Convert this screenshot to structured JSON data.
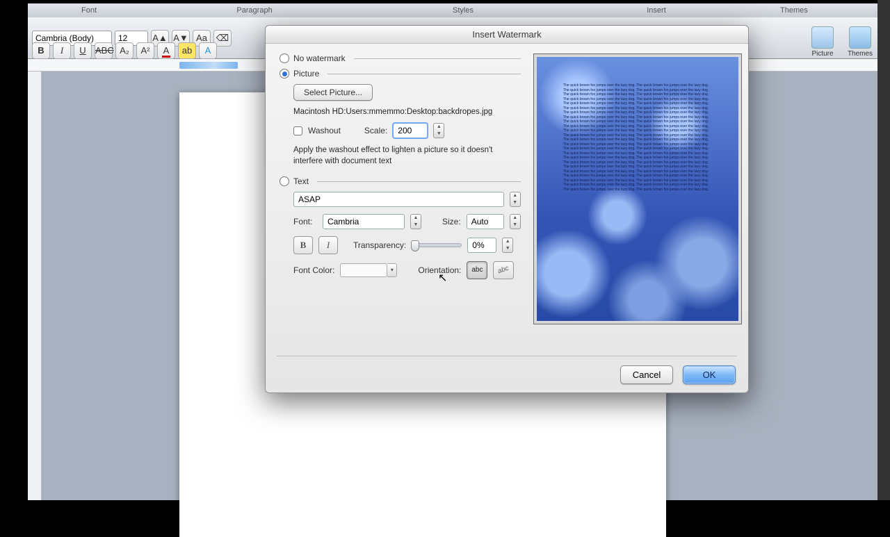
{
  "ribbon": {
    "tabs": [
      "",
      "Font",
      "",
      "Paragraph",
      "",
      "Styles",
      "",
      "Insert",
      "Themes"
    ],
    "font_name": "Cambria (Body)",
    "font_size": "12",
    "group_insert": {
      "picture": "Picture",
      "themes": "Themes"
    }
  },
  "dialog": {
    "title": "Insert Watermark",
    "no_watermark": "No watermark",
    "picture": "Picture",
    "select_picture": "Select Picture...",
    "path": "Macintosh HD:Users:mmemmo:Desktop:backdropes.jpg",
    "washout": "Washout",
    "scale_label": "Scale:",
    "scale_value": "200",
    "hint": "Apply the washout effect to lighten a picture so it doesn't interfere with document text",
    "text": "Text",
    "text_value": "ASAP",
    "font_label": "Font:",
    "font_value": "Cambria",
    "size_label": "Size:",
    "size_value": "Auto",
    "transparency_label": "Transparency:",
    "transparency_value": "0%",
    "font_color_label": "Font Color:",
    "orientation_label": "Orientation:",
    "orientation_horizontal": "abc",
    "orientation_diagonal": "abc",
    "cancel": "Cancel",
    "ok": "OK"
  },
  "preview_para": "The quick brown fox jumps over the lazy dog. The quick brown fox jumps over the lazy dog. The quick brown fox jumps over the lazy dog. The quick brown fox jumps over the lazy dog. The quick brown fox jumps over the lazy dog. The quick brown fox jumps over the lazy dog. The quick brown fox jumps over the lazy dog. The quick brown fox jumps over the lazy dog. The quick brown fox jumps over the lazy dog. The quick brown fox jumps over the lazy dog. The quick brown fox jumps over the lazy dog. The quick brown fox jumps over the lazy dog. The quick brown fox jumps over the lazy dog. The quick brown fox jumps over the lazy dog. The quick brown fox jumps over the lazy dog. The quick brown fox jumps over the lazy dog. The quick brown fox jumps over the lazy dog. The quick brown fox jumps over the lazy dog. The quick brown fox jumps over the lazy dog. The quick brown fox jumps over the lazy dog. The quick brown fox jumps over the lazy dog. The quick brown fox jumps over the lazy dog. The quick brown fox jumps over the lazy dog. The quick brown fox jumps over the lazy dog. The quick brown fox jumps over the lazy dog. The quick brown fox jumps over the lazy dog. The quick brown fox jumps over the lazy dog. The quick brown fox jumps over the lazy dog. The quick brown fox jumps over the lazy dog. The quick brown fox jumps over the lazy dog. The quick brown fox jumps over the lazy dog. The quick brown fox jumps over the lazy dog. The quick brown fox jumps over the lazy dog. The quick brown fox jumps over the lazy dog. The quick brown fox jumps over the lazy dog. The quick brown fox jumps over the lazy dog. The quick brown fox jumps over the lazy dog. The quick brown fox jumps over the lazy dog. The quick brown fox jumps over the lazy dog. The quick brown fox jumps over the lazy dog. The quick brown fox jumps over the lazy dog. The quick brown fox jumps over the lazy dog. The quick brown fox jumps over the lazy dog. The quick brown fox jumps over the lazy dog. The quick brown fox jumps over the lazy dog. The quick brown fox jumps over the lazy dog. The quick brown fox jumps over the lazy dog. The quick brown fox jumps over the lazy dog."
}
